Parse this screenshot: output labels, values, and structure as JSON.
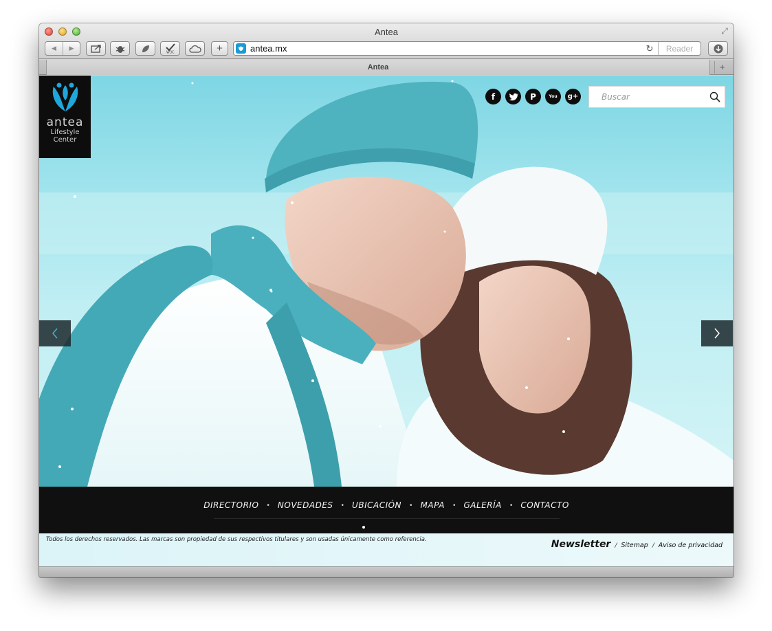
{
  "browser": {
    "window_title": "Antea",
    "url": "antea.mx",
    "reader_label": "Reader",
    "tab_title": "Antea",
    "new_tab_symbol": "+"
  },
  "site": {
    "logo": {
      "wordmark": "antea",
      "sub_line1": "Lifestyle",
      "sub_line2": "Center"
    },
    "social": [
      {
        "name": "facebook",
        "glyph": "f"
      },
      {
        "name": "twitter",
        "glyph": "t"
      },
      {
        "name": "pinterest",
        "glyph": "P"
      },
      {
        "name": "youtube",
        "glyph": "You"
      },
      {
        "name": "google-plus",
        "glyph": "g+"
      }
    ],
    "search": {
      "placeholder": "Buscar"
    },
    "nav": [
      "DIRECTORIO",
      "NOVEDADES",
      "UBICACIÓN",
      "MAPA",
      "GALERÍA",
      "CONTACTO"
    ],
    "footer": {
      "copyright": "Todos los derechos reservados. Las marcas son propiedad de sus respectivos titulares y son usadas únicamente como referencia.",
      "newsletter": "Newsletter",
      "separator": "/",
      "sitemap": "Sitemap",
      "privacy": "Aviso de privacidad"
    }
  },
  "colors": {
    "accent": "#1b9ad6",
    "nav_bg": "#101010",
    "hero_sky": "#7ed6e4"
  }
}
